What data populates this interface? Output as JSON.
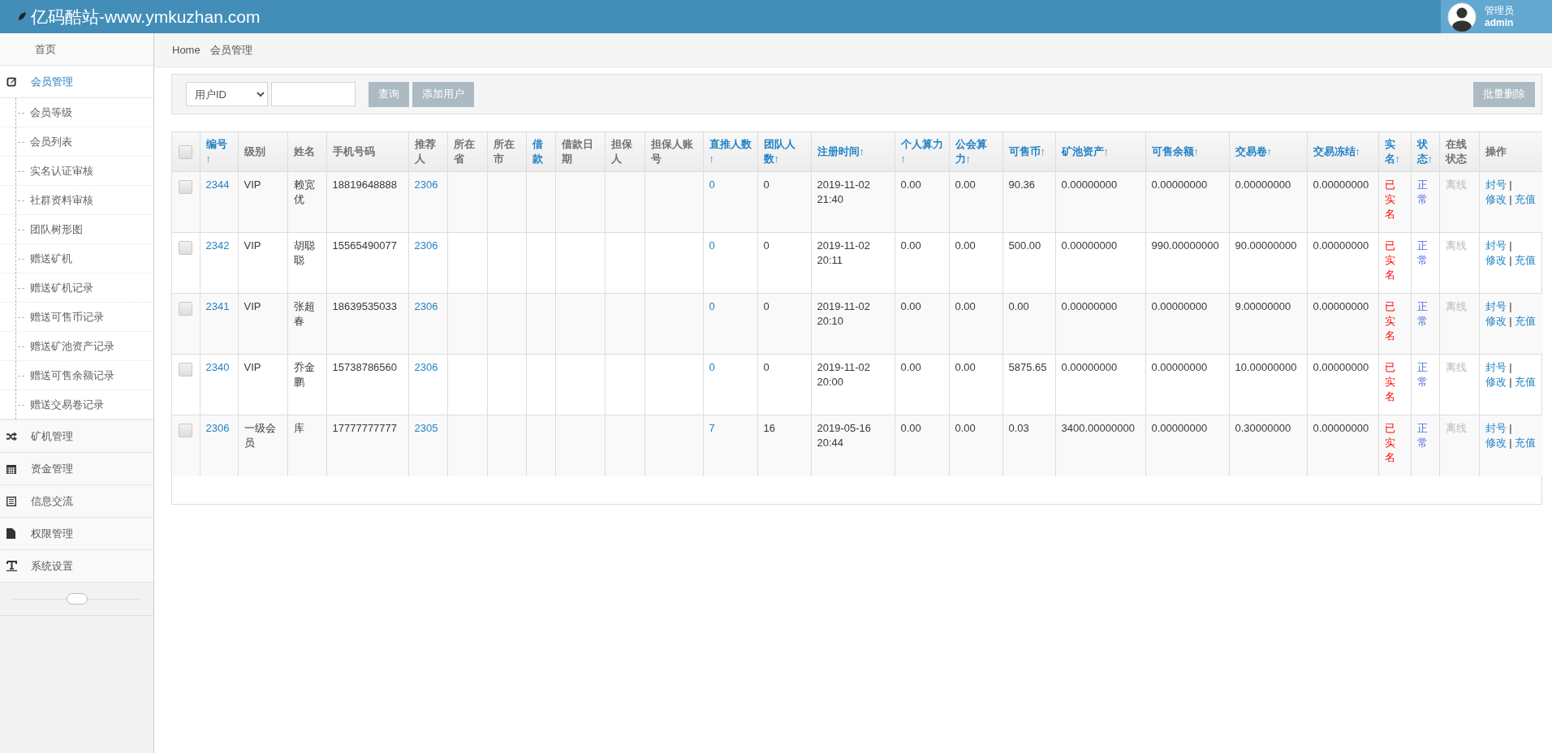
{
  "header": {
    "title": "亿码酷站-www.ymkuzhan.com",
    "user_role": "管理员",
    "user_name": "admin"
  },
  "sidebar": {
    "items": [
      {
        "kind": "plain",
        "label": "首页",
        "selected": false
      },
      {
        "kind": "menu",
        "label": "会员管理",
        "selected": true,
        "children": [
          {
            "label": "会员等级",
            "selected": false
          },
          {
            "label": "会员列表",
            "selected": false
          },
          {
            "label": "实名认证审核",
            "selected": false
          },
          {
            "label": "社群资料审核",
            "selected": false
          },
          {
            "label": "团队树形图",
            "selected": false
          },
          {
            "label": "赠送矿机",
            "selected": false
          },
          {
            "label": "赠送矿机记录",
            "selected": false
          },
          {
            "label": "赠送可售币记录",
            "selected": false
          },
          {
            "label": "赠送矿池资产记录",
            "selected": false
          },
          {
            "label": "赠送可售余额记录",
            "selected": false
          },
          {
            "label": "赠送交易卷记录",
            "selected": false
          }
        ]
      },
      {
        "kind": "menu",
        "label": "矿机管理",
        "selected": false
      },
      {
        "kind": "menu",
        "label": "资金管理",
        "selected": false
      },
      {
        "kind": "menu",
        "label": "信息交流",
        "selected": false
      },
      {
        "kind": "menu",
        "label": "权限管理",
        "selected": false
      },
      {
        "kind": "menu",
        "label": "系统设置",
        "selected": false
      }
    ]
  },
  "breadcrumb": [
    "Home",
    "会员管理"
  ],
  "toolbar": {
    "filter_select": "用户ID",
    "buttons": [
      "查询",
      "添加用户"
    ],
    "bulk_button": "批量删除"
  },
  "table": {
    "select_all_checked": false,
    "action_separator": "|",
    "columns": [
      {
        "label": "编号↑",
        "kind": "link",
        "sortable": true
      },
      {
        "label": "级别",
        "kind": "text",
        "sortable": false
      },
      {
        "label": "姓名",
        "kind": "text",
        "sortable": false
      },
      {
        "label": "手机号码",
        "kind": "text",
        "sortable": false
      },
      {
        "label": "推荐人",
        "kind": "link",
        "sortable": false
      },
      {
        "label": "所在省",
        "kind": "text",
        "sortable": false
      },
      {
        "label": "所在市",
        "kind": "text",
        "sortable": false
      },
      {
        "label": "借款",
        "kind": "text",
        "sortable": true
      },
      {
        "label": "借款日期",
        "kind": "text",
        "sortable": false
      },
      {
        "label": "担保人",
        "kind": "text",
        "sortable": false
      },
      {
        "label": "担保人账号",
        "kind": "text",
        "sortable": false
      },
      {
        "label": "直推人数↑",
        "kind": "link",
        "sortable": true
      },
      {
        "label": "团队人数↑",
        "kind": "text",
        "sortable": true
      },
      {
        "label": "注册时间↑",
        "kind": "text",
        "sortable": true
      },
      {
        "label": "个人算力↑",
        "kind": "text",
        "sortable": true
      },
      {
        "label": "公会算力↑",
        "kind": "text",
        "sortable": true
      },
      {
        "label": "可售币↑",
        "kind": "text",
        "sortable": true
      },
      {
        "label": "矿池资产↑",
        "kind": "text",
        "sortable": true
      },
      {
        "label": "可售余额↑",
        "kind": "text",
        "sortable": true
      },
      {
        "label": "交易卷↑",
        "kind": "text",
        "sortable": true
      },
      {
        "label": "交易冻结↑",
        "kind": "text",
        "sortable": true
      },
      {
        "label": "实名↑",
        "kind": "danger",
        "sortable": true
      },
      {
        "label": "状态↑",
        "kind": "status",
        "sortable": true
      },
      {
        "label": "在线状态",
        "kind": "muted",
        "sortable": false
      },
      {
        "label": "操作",
        "kind": "actions",
        "sortable": false
      }
    ],
    "rows": [
      {
        "selected": false,
        "cells": [
          "2344",
          "VIP",
          "赖宽优",
          "18819648888",
          "2306",
          null,
          null,
          null,
          null,
          null,
          null,
          "0",
          "0",
          "2019-11-02 21:40",
          "0.00",
          "0.00",
          "90.36",
          "0.00000000",
          "0.00000000",
          "0.00000000",
          "0.00000000",
          "已实名",
          "正常",
          "离线"
        ],
        "actions": [
          "封号",
          "修改",
          "充值"
        ]
      },
      {
        "selected": false,
        "cells": [
          "2342",
          "VIP",
          "胡聪聪",
          "15565490077",
          "2306",
          null,
          null,
          null,
          null,
          null,
          null,
          "0",
          "0",
          "2019-11-02 20:11",
          "0.00",
          "0.00",
          "500.00",
          "0.00000000",
          "990.00000000",
          "90.00000000",
          "0.00000000",
          "已实名",
          "正常",
          "离线"
        ],
        "actions": [
          "封号",
          "修改",
          "充值"
        ]
      },
      {
        "selected": false,
        "cells": [
          "2341",
          "VIP",
          "张超春",
          "18639535033",
          "2306",
          null,
          null,
          null,
          null,
          null,
          null,
          "0",
          "0",
          "2019-11-02 20:10",
          "0.00",
          "0.00",
          "0.00",
          "0.00000000",
          "0.00000000",
          "9.00000000",
          "0.00000000",
          "已实名",
          "正常",
          "离线"
        ],
        "actions": [
          "封号",
          "修改",
          "充值"
        ]
      },
      {
        "selected": false,
        "cells": [
          "2340",
          "VIP",
          "乔金鹏",
          "15738786560",
          "2306",
          null,
          null,
          null,
          null,
          null,
          null,
          "0",
          "0",
          "2019-11-02 20:00",
          "0.00",
          "0.00",
          "5875.65",
          "0.00000000",
          "0.00000000",
          "10.00000000",
          "0.00000000",
          "已实名",
          "正常",
          "离线"
        ],
        "actions": [
          "封号",
          "修改",
          "充值"
        ]
      },
      {
        "selected": false,
        "cells": [
          "2306",
          "一级会员",
          "库",
          "17777777777",
          "2305",
          null,
          null,
          null,
          null,
          null,
          null,
          "7",
          "16",
          "2019-05-16 20:44",
          "0.00",
          "0.00",
          "0.03",
          "3400.00000000",
          "0.00000000",
          "0.30000000",
          "0.00000000",
          "已实名",
          "正常",
          "离线"
        ],
        "actions": [
          "封号",
          "修改",
          "充值"
        ]
      }
    ]
  }
}
